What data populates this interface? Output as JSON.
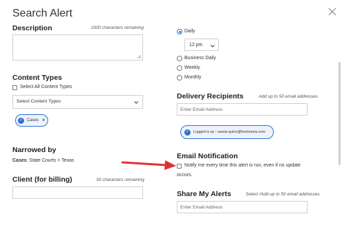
{
  "dialog": {
    "title": "Search Alert"
  },
  "description": {
    "label": "Description",
    "hint": "1000 characters remaining",
    "value": ""
  },
  "content_types": {
    "label": "Content Types",
    "select_all_label": "Select All Content Types",
    "select_all_checked": false,
    "dropdown_placeholder": "Select Content Types",
    "chips": [
      {
        "label": "Cases"
      }
    ]
  },
  "narrowed_by": {
    "label": "Narrowed by",
    "key": "Cases",
    "value": ": State Courts > Texas"
  },
  "client": {
    "label": "Client (for billing)",
    "hint": "50 characters remaining",
    "value": ""
  },
  "frequency": {
    "selected": "Daily",
    "options": [
      "Daily",
      "Business Daily",
      "Weekly",
      "Monthly"
    ],
    "time_value": "12 pm"
  },
  "delivery": {
    "label": "Delivery Recipients",
    "hint": "Add up to 50 email addresses",
    "placeholder": "Enter Email Address",
    "logged_in_chip": "Logged in as : cassie.quinn@foxlonesis.com"
  },
  "email_notification": {
    "label": "Email Notification",
    "option_line1": "Notify me every time this alert is run, even if no update",
    "option_line2": "occurs.",
    "checked": false
  },
  "share": {
    "label": "Share My Alerts",
    "hint": "Select /Add up to 50 email addresses",
    "placeholder": "Enter Email Address"
  },
  "colors": {
    "accent": "#2b6fd6",
    "arrow": "#e03131"
  }
}
